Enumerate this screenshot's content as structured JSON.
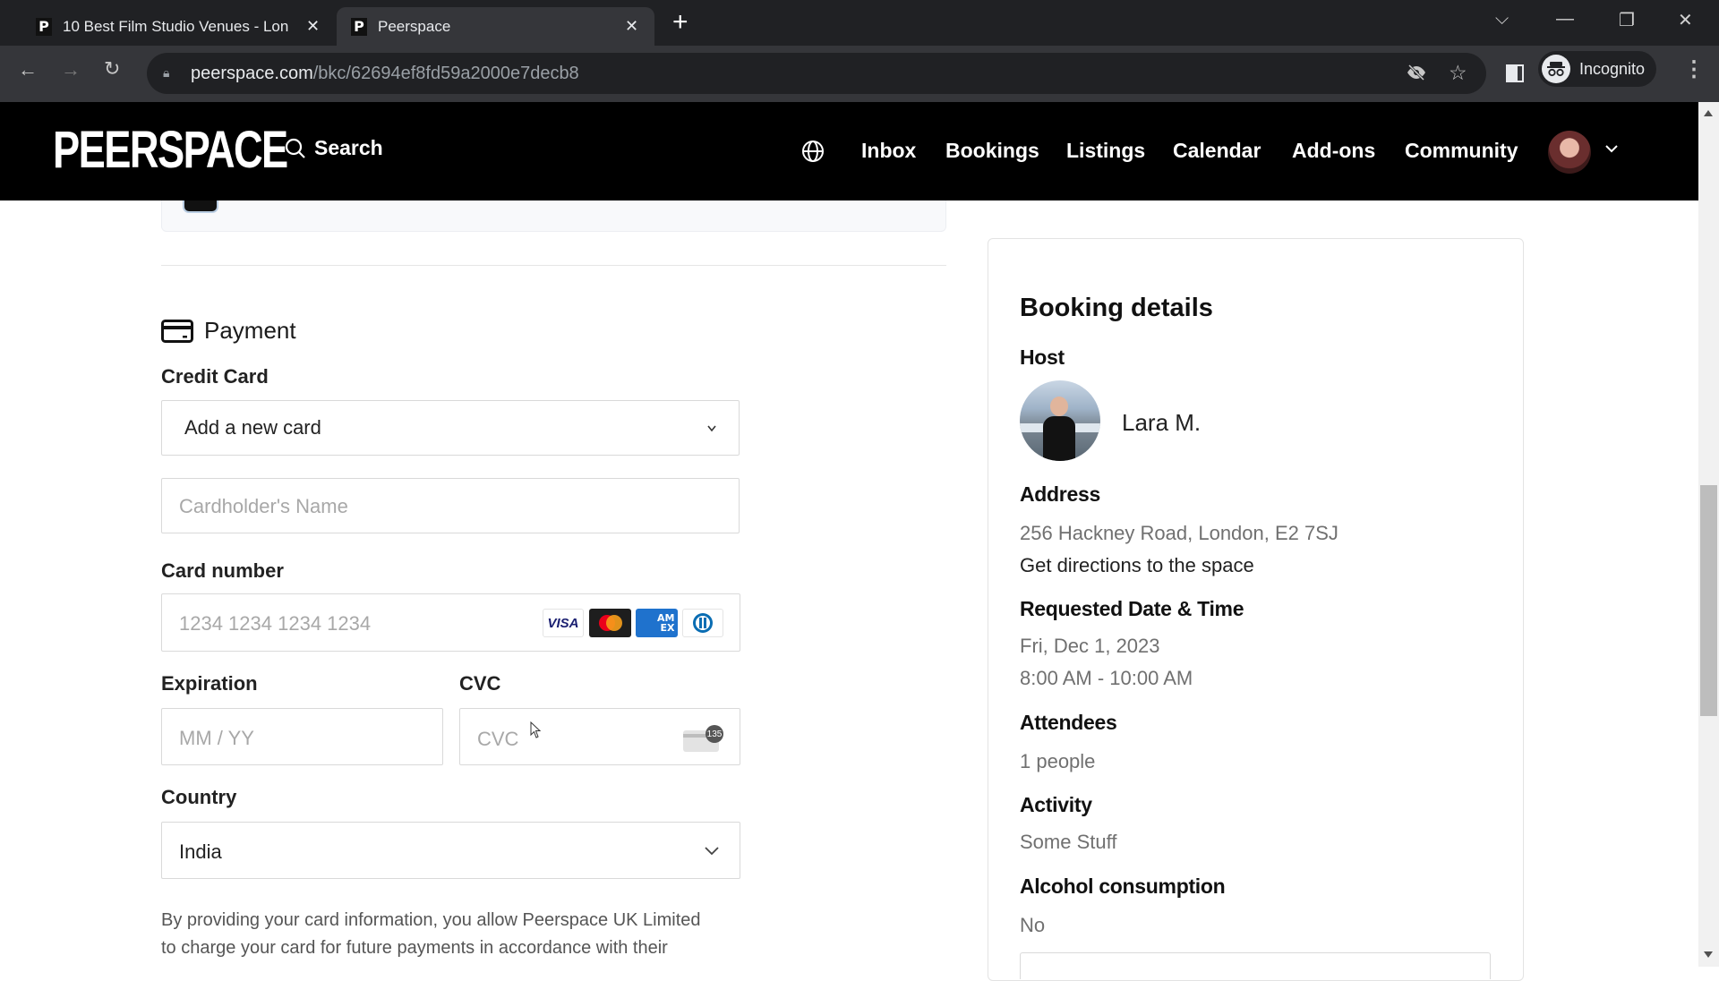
{
  "browser": {
    "tabs": [
      {
        "title": "10 Best Film Studio Venues - Lon",
        "favicon": "P",
        "active": false
      },
      {
        "title": "Peerspace",
        "favicon": "P",
        "active": true
      }
    ],
    "new_tab_icon": "plus-icon",
    "url_domain": "peerspace.com",
    "url_path": "/bkc/62694ef8fd59a2000e7decb8",
    "profile_label": "Incognito"
  },
  "navbar": {
    "logo": "PEERSPACE",
    "search_label": "Search",
    "links": [
      "Inbox",
      "Bookings",
      "Listings",
      "Calendar",
      "Add-ons",
      "Community"
    ]
  },
  "payment": {
    "title": "Payment",
    "credit_card_label": "Credit Card",
    "credit_card_selected": "Add a new card",
    "cardholder_placeholder": "Cardholder's Name",
    "card_number_label": "Card number",
    "card_number_placeholder": "1234 1234 1234 1234",
    "card_brands": [
      "VISA",
      "Mastercard",
      "AMEX",
      "Diners Club"
    ],
    "expiration_label": "Expiration",
    "expiration_placeholder": "MM / YY",
    "cvc_label": "CVC",
    "cvc_placeholder": "CVC",
    "cvc_hint": "135",
    "country_label": "Country",
    "country_selected": "India",
    "disclaimer_line1": "By providing your card information, you allow Peerspace UK Limited",
    "disclaimer_line2": "to charge your card for future payments in accordance with their"
  },
  "booking": {
    "title": "Booking details",
    "host_label": "Host",
    "host_name": "Lara M.",
    "address_label": "Address",
    "address": "256 Hackney Road, London, E2 7SJ",
    "directions_link": "Get directions to the space",
    "datetime_label": "Requested Date & Time",
    "date": "Fri, Dec 1, 2023",
    "time": "8:00 AM - 10:00 AM",
    "attendees_label": "Attendees",
    "attendees": "1 people",
    "activity_label": "Activity",
    "activity": "Some Stuff",
    "alcohol_label": "Alcohol consumption",
    "alcohol": "No"
  },
  "colors": {
    "navbar_bg": "#000000",
    "visa_blue": "#1a1f71",
    "amex_blue": "#1f72cd",
    "mastercard_red": "#eb001b",
    "mastercard_orange": "#f79e1b"
  }
}
